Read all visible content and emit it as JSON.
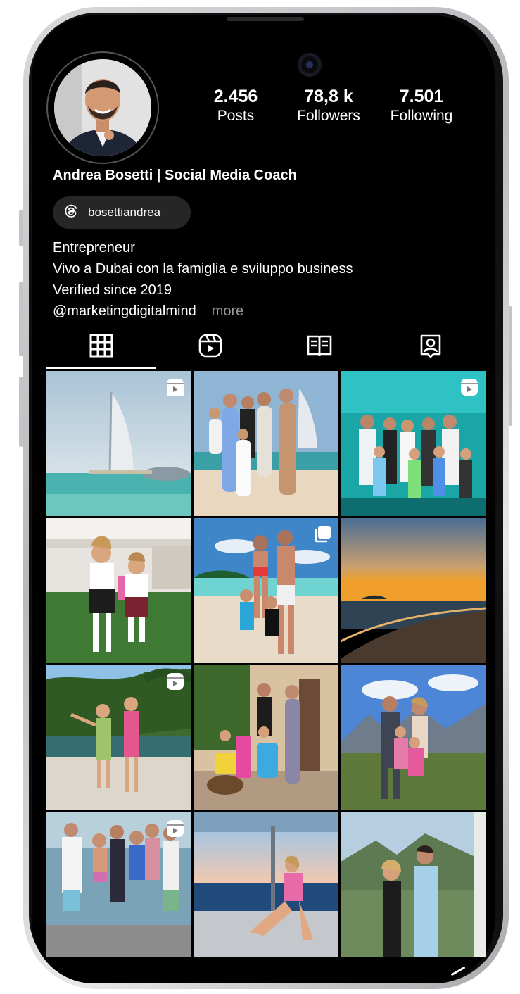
{
  "profile": {
    "name": "Andrea Bosetti | Social Media Coach",
    "threads_handle": "bosettiandrea",
    "bio_lines": [
      "Entrepreneur",
      "Vivo a Dubai con la famiglia e sviluppo business",
      "Verified since 2019"
    ],
    "link": "@marketingdigitalmind",
    "more_label": "more"
  },
  "stats": {
    "posts": {
      "value": "2.456",
      "label": "Posts"
    },
    "followers": {
      "value": "78,8 k",
      "label": "Followers"
    },
    "following": {
      "value": "7.501",
      "label": "Following"
    }
  },
  "tabs": [
    {
      "icon": "grid-icon",
      "active": true
    },
    {
      "icon": "reels-icon",
      "active": false
    },
    {
      "icon": "guides-icon",
      "active": false
    },
    {
      "icon": "tagged-icon",
      "active": false
    }
  ],
  "posts": [
    {
      "scene": "burj-al-arab",
      "badge": "reel-icon"
    },
    {
      "scene": "family-beach-burj",
      "badge": null
    },
    {
      "scene": "aquarium-group",
      "badge": "reel-icon"
    },
    {
      "scene": "kids-school-lawn",
      "badge": null
    },
    {
      "scene": "family-maldives-beach",
      "badge": "carousel-icon"
    },
    {
      "scene": "sunset-beach",
      "badge": null
    },
    {
      "scene": "girls-pool-jungle",
      "badge": "reel-icon"
    },
    {
      "scene": "family-luggage",
      "badge": null
    },
    {
      "scene": "family-mountains",
      "badge": null
    },
    {
      "scene": "friends-boat",
      "badge": "reel-icon"
    },
    {
      "scene": "woman-boat-sunset",
      "badge": null
    },
    {
      "scene": "couple-capri",
      "badge": null
    }
  ]
}
